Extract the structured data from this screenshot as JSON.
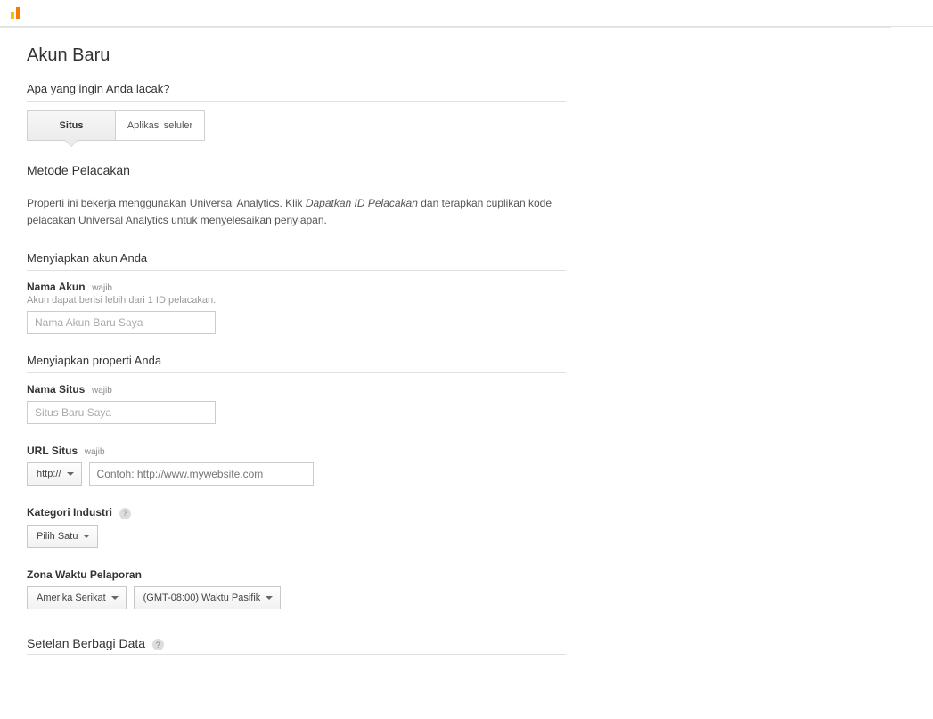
{
  "topbar": {
    "logo_alt": "analytics-logo"
  },
  "page": {
    "title": "Akun Baru"
  },
  "track_section": {
    "heading": "Apa yang ingin Anda lacak?",
    "tabs": {
      "web": "Situs",
      "app": "Aplikasi seluler"
    }
  },
  "method": {
    "title": "Metode Pelacakan",
    "desc_pre": "Properti ini bekerja menggunakan Universal Analytics. Klik ",
    "desc_em": "Dapatkan ID Pelacakan",
    "desc_post": " dan terapkan cuplikan kode pelacakan Universal Analytics untuk menyelesaikan penyiapan."
  },
  "account_setup": {
    "heading": "Menyiapkan akun Anda",
    "name_label": "Nama Akun",
    "name_req": "wajib",
    "name_hint": "Akun dapat berisi lebih dari 1 ID pelacakan.",
    "name_placeholder": "Nama Akun Baru Saya"
  },
  "property_setup": {
    "heading": "Menyiapkan properti Anda",
    "site_name_label": "Nama Situs",
    "site_name_req": "wajib",
    "site_name_placeholder": "Situs Baru Saya",
    "site_url_label": "URL Situs",
    "site_url_req": "wajib",
    "protocol": "http://",
    "url_placeholder": "Contoh: http://www.mywebsite.com",
    "category_label": "Kategori Industri",
    "category_value": "Pilih Satu",
    "timezone_label": "Zona Waktu Pelaporan",
    "country": "Amerika Serikat",
    "timezone": "(GMT-08:00) Waktu Pasifik"
  },
  "sharing": {
    "title": "Setelan Berbagi Data"
  },
  "help": "?"
}
